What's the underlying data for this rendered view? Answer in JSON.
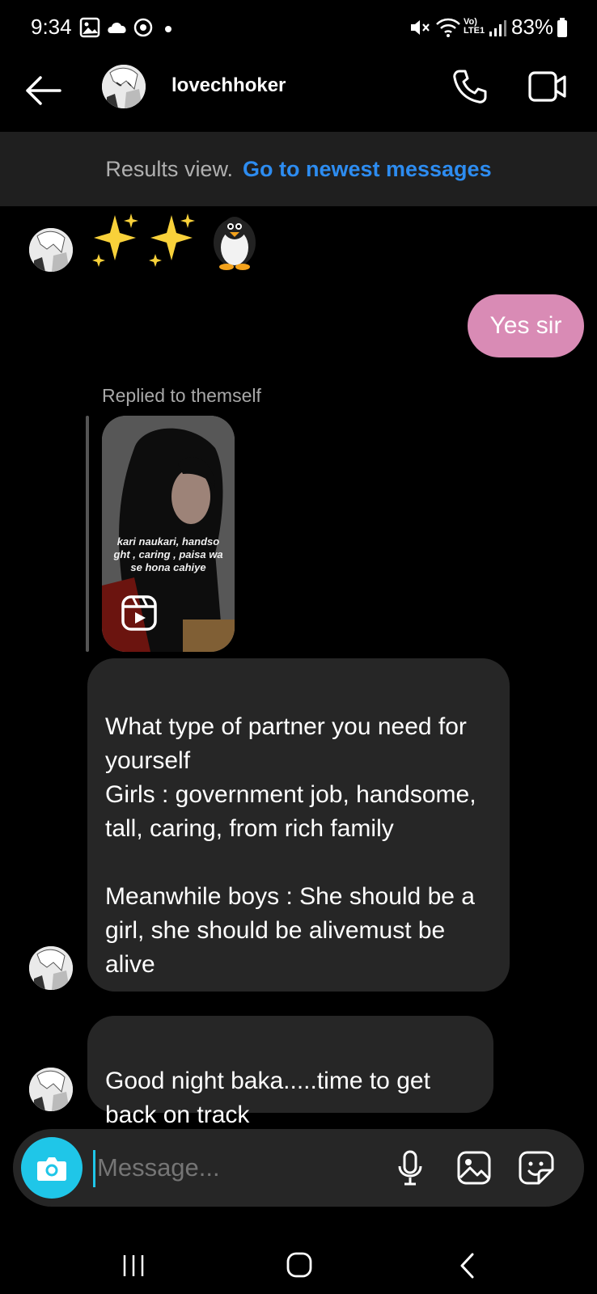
{
  "status_bar": {
    "time": "9:34",
    "network_label": "Vo) LTE1",
    "battery": "83%"
  },
  "header": {
    "contact_name": "lovechhoker"
  },
  "results_banner": {
    "label": "Results view.",
    "link": "Go to newest messages"
  },
  "messages": {
    "emoji_message": "✨✨🐧",
    "sent_reply": "Yes sir",
    "reply_caption": "Replied to themself",
    "reel_overlay_text": "kari naukari, handso\nght , caring , paisa wa\nse hona cahiye",
    "partner_message": "What type of partner you need for yourself\nGirls : government job, handsome, tall, caring, from rich family\n\nMeanwhile boys : She should be a girl, she should be alivemust be alive",
    "goodnight_message": "Good night baka.....time to get back on track"
  },
  "composer": {
    "placeholder": "Message..."
  },
  "colors": {
    "background": "#000000",
    "incoming_bubble": "#262626",
    "outgoing_bubble": "#d98bb5",
    "link_blue": "#2d8cf0",
    "camera_button": "#1fc6e8"
  },
  "icons": {
    "back": "arrow-left-icon",
    "call": "phone-icon",
    "video": "video-camera-icon",
    "camera": "camera-icon",
    "mic": "microphone-icon",
    "gallery": "image-icon",
    "sticker": "sticker-icon",
    "reel": "reel-icon"
  }
}
